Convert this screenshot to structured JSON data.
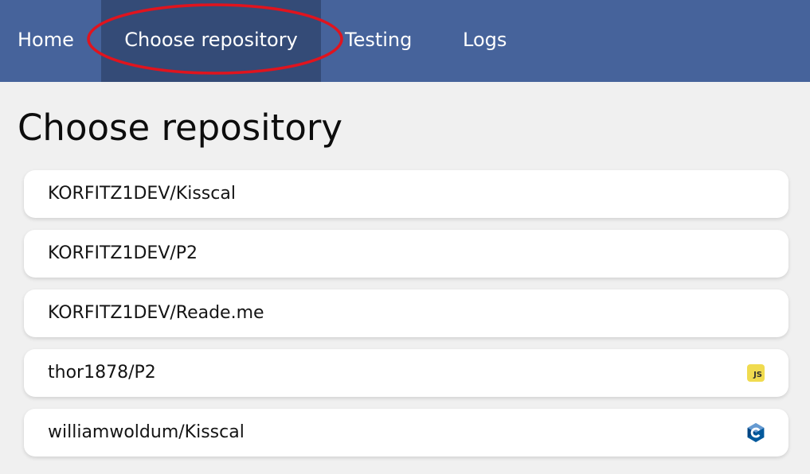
{
  "nav": {
    "items": [
      {
        "label": "Home"
      },
      {
        "label": "Choose repository"
      },
      {
        "label": "Testing"
      },
      {
        "label": "Logs"
      }
    ],
    "active": "Choose repository",
    "colors": {
      "bar": "#46639b",
      "active": "#344b77",
      "annotation": "#e0141e"
    }
  },
  "page": {
    "title": "Choose repository"
  },
  "repositories": [
    {
      "name": "KORFITZ1DEV/Kisscal",
      "language_icon": ""
    },
    {
      "name": "KORFITZ1DEV/P2",
      "language_icon": ""
    },
    {
      "name": "KORFITZ1DEV/Reade.me",
      "language_icon": ""
    },
    {
      "name": "thor1878/P2",
      "language_icon": "javascript-icon",
      "badge_text": "JS"
    },
    {
      "name": "williamwoldum/Kisscal",
      "language_icon": "c-language-icon"
    }
  ]
}
